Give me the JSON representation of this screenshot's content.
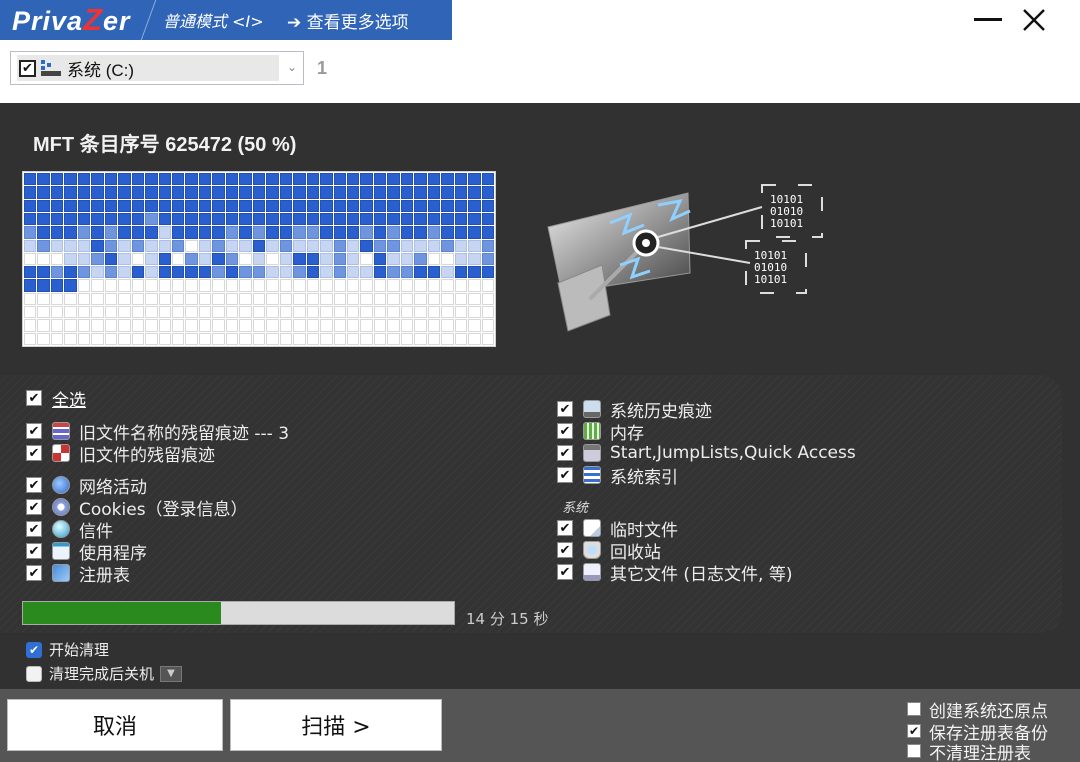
{
  "title_bar": {
    "logo_pre": "Priva",
    "logo_z": "Z",
    "logo_post": "er",
    "mode": "普通模式 <I>",
    "more_options": "➔ 查看更多选项",
    "minimize_icon": "minimize-icon",
    "close_icon": "close-icon"
  },
  "drive_selector": {
    "checked": true,
    "label": "系统 (C:)",
    "count": "1"
  },
  "status": {
    "text": "MFT 条目序号 625472 (50 %)"
  },
  "mft_map": {
    "rows": [
      "33333333333333333333333333333333333",
      "33333333333333333333333333333333333",
      "33333333333333333333333333333333333",
      "33333333323333333333333333333333333",
      "23332323331333323233223332323323333",
      "12111321211201211312111213221112112",
      "00011231013021320101331210311200112",
      "33232121313333232211231211322331333",
      "33330000000000000000000000000000000",
      "00000000000000000000000000000000000",
      "00000000000000000000000000000000000",
      "00000000000000000000000000000000000",
      "00000000000000000000000000000000000"
    ]
  },
  "options": {
    "select_all": "全选",
    "left": [
      {
        "label": "旧文件名称的残留痕迹 ---  3",
        "icon": "list-icon",
        "checked": true
      },
      {
        "label": "旧文件的残留痕迹",
        "icon": "grid-icon",
        "checked": true
      },
      {
        "label": "网络活动",
        "icon": "globe-icon",
        "checked": true
      },
      {
        "label": "Cookies（登录信息）",
        "icon": "cookie-icon",
        "checked": true
      },
      {
        "label": "信件",
        "icon": "mail-icon",
        "checked": true
      },
      {
        "label": "使用程序",
        "icon": "program-icon",
        "checked": true
      },
      {
        "label": "注册表",
        "icon": "registry-icon",
        "checked": true
      }
    ],
    "right": [
      {
        "label": "系统历史痕迹",
        "icon": "monitor-icon",
        "checked": true
      },
      {
        "label": "内存",
        "icon": "memory-icon",
        "checked": true
      },
      {
        "label": "Start,JumpLists,Quick Access",
        "icon": "start-menu-icon",
        "checked": true
      },
      {
        "label": "系统索引",
        "icon": "index-icon",
        "checked": true
      },
      {
        "label": "临时文件",
        "icon": "file-icon",
        "checked": true
      },
      {
        "label": "回收站",
        "icon": "recycle-bin-icon",
        "checked": true
      },
      {
        "label": "其它文件 (日志文件, 等)",
        "icon": "document-icon",
        "checked": true
      }
    ],
    "system_category": "系统"
  },
  "progress": {
    "fraction": 0.46,
    "time_remaining": "14 分 15 秒"
  },
  "flags": {
    "start_clean": {
      "label": "开始清理",
      "checked": true
    },
    "shutdown_after": {
      "label": "清理完成后关机",
      "checked": false
    }
  },
  "buttons": {
    "cancel": "取消",
    "scan": "扫描 >"
  },
  "bottom_options": [
    {
      "label": "创建系统还原点",
      "checked": false
    },
    {
      "label": "保存注册表备份",
      "checked": true
    },
    {
      "label": "不清理注册表",
      "checked": false
    }
  ],
  "colors": {
    "title_blue": "#2f64b7",
    "progress_green": "#2b8a1e",
    "map_blue": "#2a5fcf",
    "dark_panel": "#313131"
  }
}
